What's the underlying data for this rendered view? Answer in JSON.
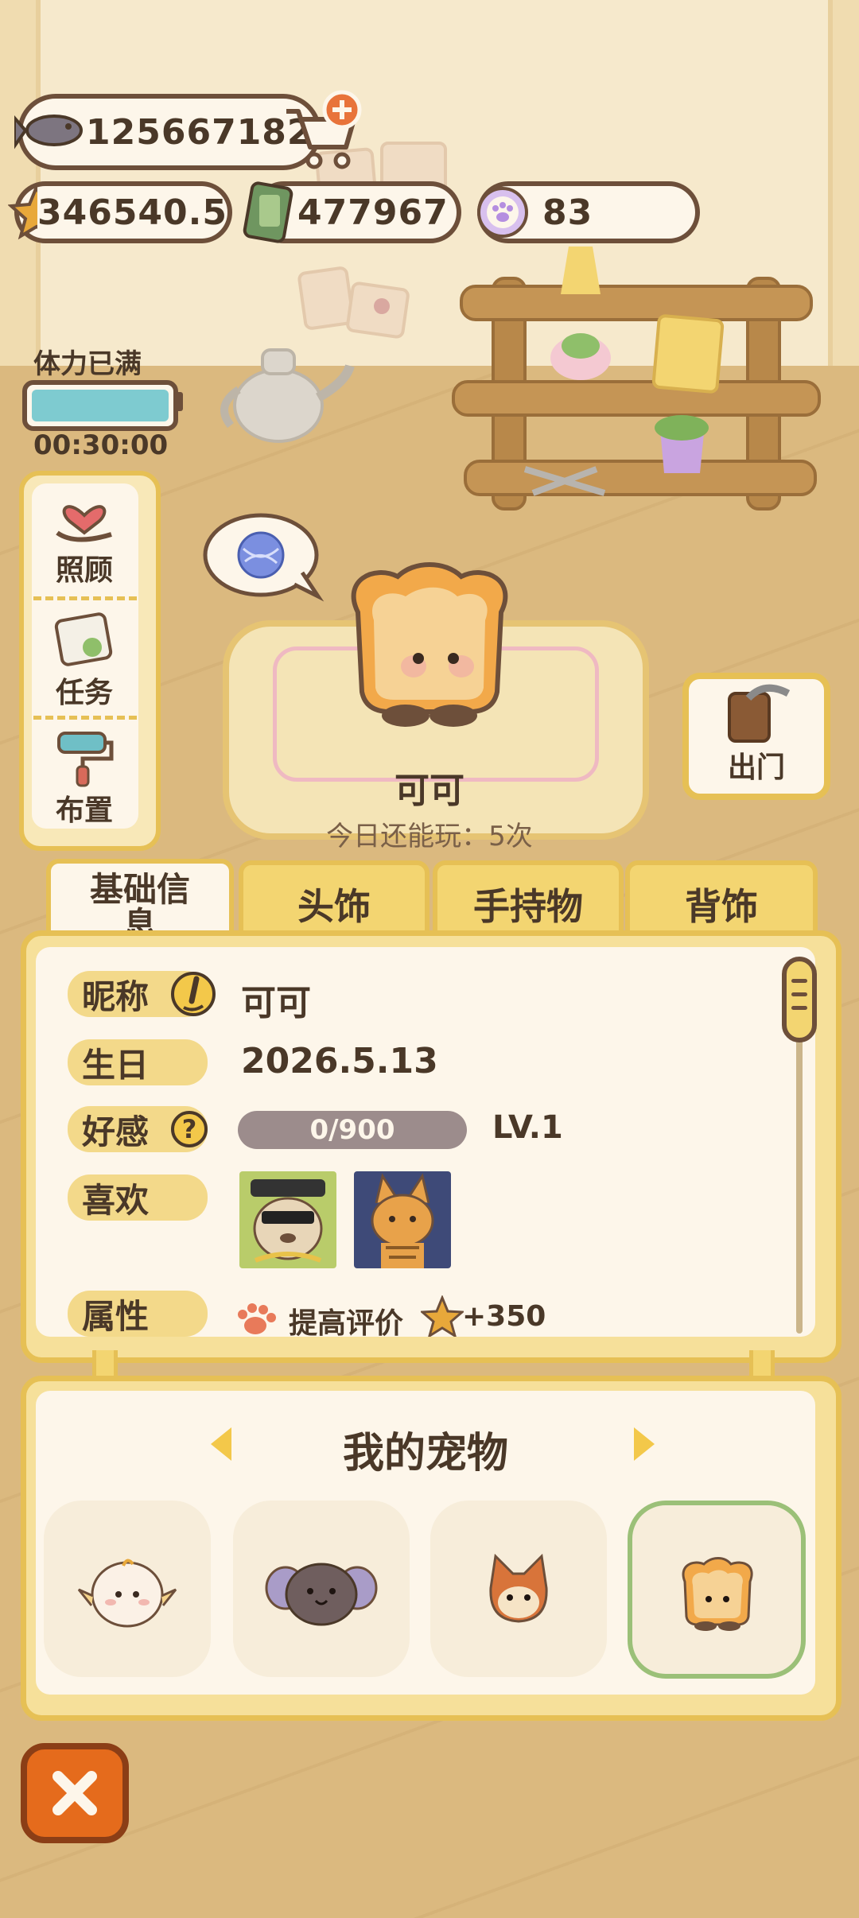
{
  "resources": {
    "fish": "125667182",
    "stars": "346540.5",
    "cash": "477967",
    "paw_tokens": "83"
  },
  "stamina": {
    "label": "体力已满",
    "timer": "00:30:00",
    "fill_fraction": 1.0
  },
  "side_menu": [
    {
      "label": "照顾",
      "icon": "heart-hand-icon"
    },
    {
      "label": "任务",
      "icon": "task-book-icon"
    },
    {
      "label": "布置",
      "icon": "paint-roller-icon"
    }
  ],
  "pet": {
    "name": "可可",
    "plays_left": "今日还能玩：5次",
    "thought_icon": "yarn-ball-icon"
  },
  "door_button": {
    "label": "出门"
  },
  "tabs": [
    {
      "label": "基础信息",
      "active": true
    },
    {
      "label": "头饰",
      "active": false
    },
    {
      "label": "手持物",
      "active": false
    },
    {
      "label": "背饰",
      "active": false
    }
  ],
  "info": {
    "nickname_label": "昵称",
    "nickname_value": "可可",
    "birthday_label": "生日",
    "birthday_value": "2026.5.13",
    "affection_label": "好感",
    "affection_value": "0/900",
    "affection_fraction": 0.0,
    "level": "LV.1",
    "likes_label": "喜欢",
    "attribute_label": "属性",
    "attribute_text": "提高评价",
    "attribute_bonus": "+350",
    "help_symbol": "?"
  },
  "my_pets": {
    "title": "我的宠物",
    "pets": [
      {
        "icon": "chick-pet-icon",
        "selected": false
      },
      {
        "icon": "elephant-pet-icon",
        "selected": false
      },
      {
        "icon": "fox-pet-icon",
        "selected": false
      },
      {
        "icon": "toast-pet-icon",
        "selected": true
      }
    ]
  },
  "colors": {
    "panel_border": "#e6c055",
    "panel_bg": "#fdf6ea",
    "selected_border": "#9bc078",
    "close_button": "#e56b1c",
    "stamina_fill": "#7ecbd0"
  }
}
